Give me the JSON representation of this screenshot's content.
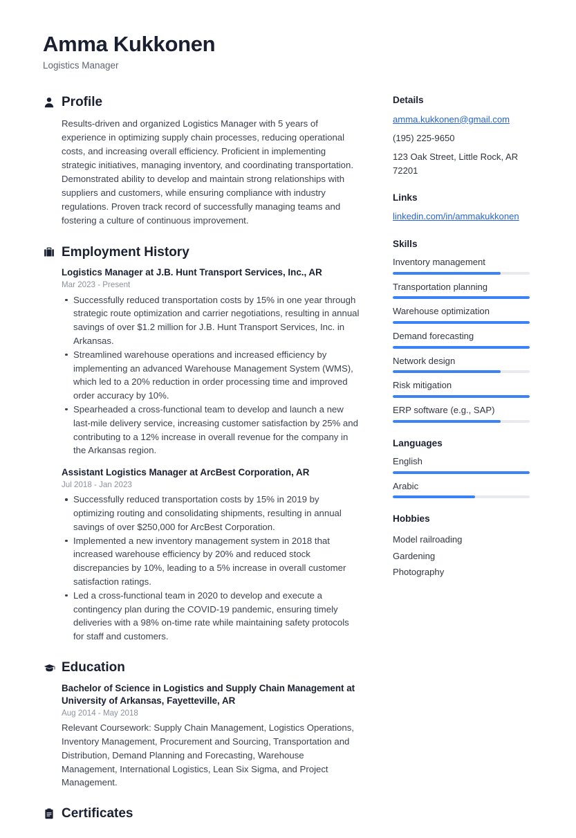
{
  "header": {
    "name": "Amma Kukkonen",
    "title": "Logistics Manager"
  },
  "colors": {
    "accent": "#3b82f6",
    "link": "#2563d6",
    "heading": "#1a2031",
    "body_text": "#3a4150",
    "muted": "#8b919c",
    "bar_track": "#e8eaed"
  },
  "sections": {
    "profile": {
      "title": "Profile",
      "icon": "person-icon",
      "text": "Results-driven and organized Logistics Manager with 5 years of experience in optimizing supply chain processes, reducing operational costs, and increasing overall efficiency. Proficient in implementing strategic initiatives, managing inventory, and coordinating transportation. Demonstrated ability to develop and maintain strong relationships with suppliers and customers, while ensuring compliance with industry regulations. Proven track record of successfully managing teams and fostering a culture of continuous improvement."
    },
    "employment": {
      "title": "Employment History",
      "icon": "briefcase-icon",
      "entries": [
        {
          "role": "Logistics Manager at J.B. Hunt Transport Services, Inc., AR",
          "date": "Mar 2023 - Present",
          "bullets": [
            "Successfully reduced transportation costs by 15% in one year through strategic route optimization and carrier negotiations, resulting in annual savings of over $1.2 million for J.B. Hunt Transport Services, Inc. in Arkansas.",
            "Streamlined warehouse operations and increased efficiency by implementing an advanced Warehouse Management System (WMS), which led to a 20% reduction in order processing time and improved order accuracy by 10%.",
            "Spearheaded a cross-functional team to develop and launch a new last-mile delivery service, increasing customer satisfaction by 25% and contributing to a 12% increase in overall revenue for the company in the Arkansas region."
          ]
        },
        {
          "role": "Assistant Logistics Manager at ArcBest Corporation, AR",
          "date": "Jul 2018 - Jan 2023",
          "bullets": [
            "Successfully reduced transportation costs by 15% in 2019 by optimizing routing and consolidating shipments, resulting in annual savings of over $250,000 for ArcBest Corporation.",
            "Implemented a new inventory management system in 2018 that increased warehouse efficiency by 20% and reduced stock discrepancies by 10%, leading to a 5% increase in overall customer satisfaction ratings.",
            "Led a cross-functional team in 2020 to develop and execute a contingency plan during the COVID-19 pandemic, ensuring timely deliveries with a 98% on-time rate while maintaining safety protocols for staff and customers."
          ]
        }
      ]
    },
    "education": {
      "title": "Education",
      "icon": "graduation-cap-icon",
      "entries": [
        {
          "degree": "Bachelor of Science in Logistics and Supply Chain Management at University of Arkansas, Fayetteville, AR",
          "date": "Aug 2014 - May 2018",
          "description": "Relevant Coursework: Supply Chain Management, Logistics Operations, Inventory Management, Procurement and Sourcing, Transportation and Distribution, Demand Planning and Forecasting, Warehouse Management, International Logistics, Lean Six Sigma, and Project Management."
        }
      ]
    },
    "certificates": {
      "title": "Certificates",
      "icon": "certificate-icon"
    }
  },
  "sidebar": {
    "details": {
      "title": "Details",
      "email": "amma.kukkonen@gmail.com",
      "phone": "(195) 225-9650",
      "address": "123 Oak Street, Little Rock, AR 72201"
    },
    "links": {
      "title": "Links",
      "items": [
        {
          "label": "linkedin.com/in/ammakukkonen"
        }
      ]
    },
    "skills": {
      "title": "Skills",
      "items": [
        {
          "label": "Inventory management",
          "level": 79
        },
        {
          "label": "Transportation planning",
          "level": 100
        },
        {
          "label": "Warehouse optimization",
          "level": 100
        },
        {
          "label": "Demand forecasting",
          "level": 100
        },
        {
          "label": "Network design",
          "level": 79
        },
        {
          "label": "Risk mitigation",
          "level": 100
        },
        {
          "label": "ERP software (e.g., SAP)",
          "level": 79
        }
      ]
    },
    "languages": {
      "title": "Languages",
      "items": [
        {
          "label": "English",
          "level": 100
        },
        {
          "label": "Arabic",
          "level": 60
        }
      ]
    },
    "hobbies": {
      "title": "Hobbies",
      "items": [
        {
          "label": "Model railroading"
        },
        {
          "label": "Gardening"
        },
        {
          "label": "Photography"
        }
      ]
    }
  }
}
